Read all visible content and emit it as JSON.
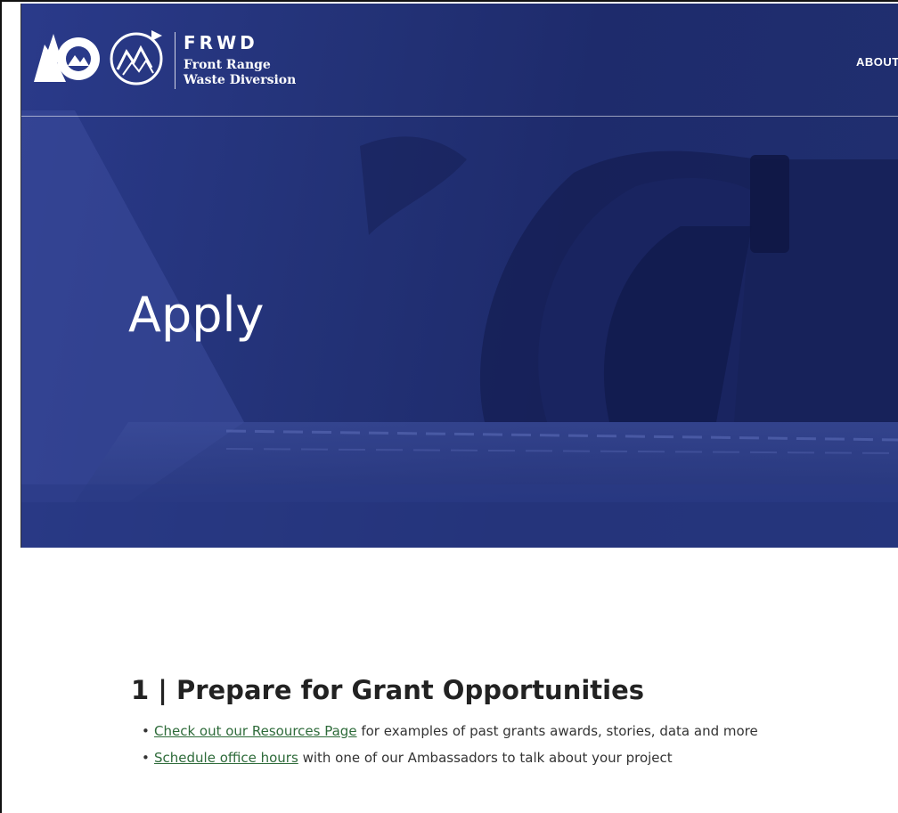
{
  "header": {
    "brand_abbr": "FRWD",
    "brand_name_line1": "Front Range",
    "brand_name_line2": "Waste Diversion",
    "nav_about": "ABOUT"
  },
  "hero": {
    "title": "Apply"
  },
  "section": {
    "heading": "1 | Prepare for Grant Opportunities",
    "items": [
      {
        "link": "Check out our Resources Page",
        "text": " for examples of past grants awards, stories, data and more"
      },
      {
        "link": "Schedule office hours",
        "text": " with one of our Ambassadors to talk about your project"
      }
    ]
  },
  "colors": {
    "hero_overlay": "#1e2b6c",
    "link": "#2e6b3a",
    "heading": "#222222"
  },
  "icons": [
    "colorado-logo-icon",
    "frwd-recycle-mountain-icon"
  ]
}
